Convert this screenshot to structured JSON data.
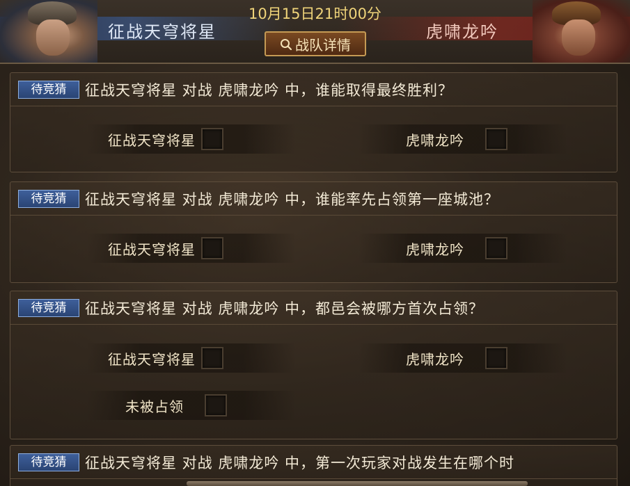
{
  "header": {
    "time": "10月15日21时00分",
    "left_team": "征战天穹将星",
    "right_team": "虎啸龙吟",
    "detail_button": "战队详情"
  },
  "questions": [
    {
      "badge": "待竞猜",
      "text": "征战天穹将星 对战 虎啸龙吟 中，谁能取得最终胜利？",
      "options": [
        "征战天穹将星",
        "虎啸龙吟"
      ]
    },
    {
      "badge": "待竞猜",
      "text": "征战天穹将星 对战 虎啸龙吟 中，谁能率先占领第一座城池？",
      "options": [
        "征战天穹将星",
        "虎啸龙吟"
      ]
    },
    {
      "badge": "待竞猜",
      "text": "征战天穹将星 对战 虎啸龙吟 中，都邑会被哪方首次占领？",
      "options": [
        "征战天穹将星",
        "虎啸龙吟",
        "未被占领"
      ]
    },
    {
      "badge": "待竞猜",
      "text": "征战天穹将星 对战 虎啸龙吟 中，第一次玩家对战发生在哪个时",
      "options": []
    }
  ],
  "colors": {
    "badge": "#2a4474",
    "button": "#4f2a12",
    "time": "#f0d47a"
  }
}
